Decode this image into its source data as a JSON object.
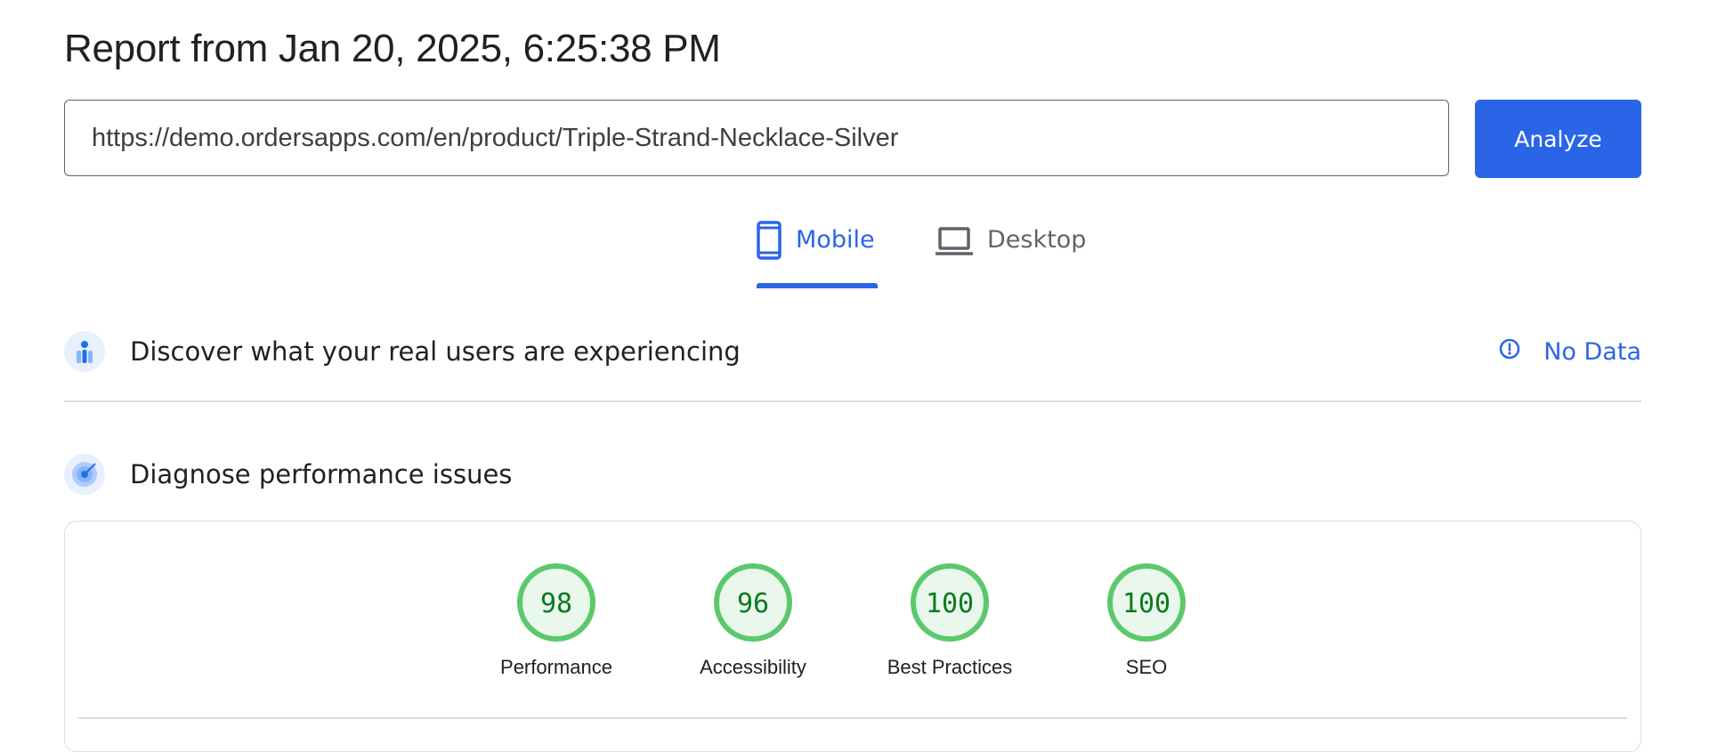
{
  "report": {
    "title": "Report from Jan 20, 2025, 6:25:38 PM"
  },
  "search": {
    "url_value": "https://demo.ordersapps.com/en/product/Triple-Strand-Necklace-Silver",
    "analyze_label": "Analyze"
  },
  "tabs": [
    {
      "label": "Mobile",
      "icon": "smartphone-icon",
      "active": true
    },
    {
      "label": "Desktop",
      "icon": "laptop-icon",
      "active": false
    }
  ],
  "field_data": {
    "title": "Discover what your real users are experiencing",
    "status_label": "No Data",
    "status_icon": "info-icon"
  },
  "lab_data": {
    "title": "Diagnose performance issues"
  },
  "scores": [
    {
      "label": "Performance",
      "value": "98"
    },
    {
      "label": "Accessibility",
      "value": "96"
    },
    {
      "label": "Best Practices",
      "value": "100"
    },
    {
      "label": "SEO",
      "value": "100"
    }
  ],
  "colors": {
    "accent": "#2a65e8",
    "pass": "#5bc96b",
    "pass_text": "#0b7a1f",
    "pass_fill": "#eaf7ec"
  }
}
